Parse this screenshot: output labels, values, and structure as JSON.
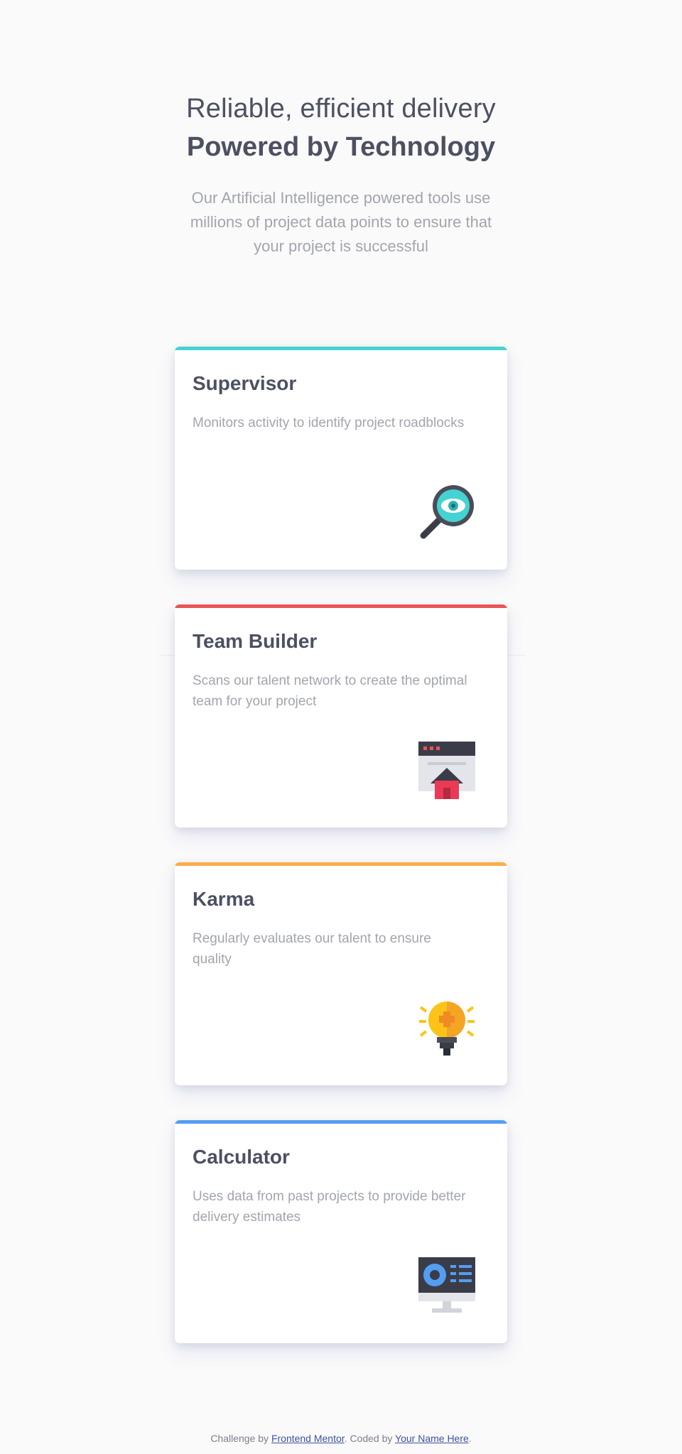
{
  "header": {
    "headline_light": "Reliable, efficient delivery",
    "headline_bold": "Powered by Technology",
    "intro": "Our Artificial Intelligence powered tools use millions of project data points to ensure that your project is successful"
  },
  "cards": [
    {
      "title": "Supervisor",
      "description": "Monitors activity to identify project roadblocks",
      "accent_color": "#44d3d2",
      "icon": "magnifier-eye-icon"
    },
    {
      "title": "Team Builder",
      "description": "Scans our talent network to create the optimal team for your project",
      "accent_color": "#ea5454",
      "icon": "browser-house-icon"
    },
    {
      "title": "Karma",
      "description": "Regularly evaluates our talent to ensure quality",
      "accent_color": "#fcae4a",
      "icon": "lightbulb-icon"
    },
    {
      "title": "Calculator",
      "description": "Uses data from past projects to provide better delivery estimates",
      "accent_color": "#549ef2",
      "icon": "monitor-chart-icon"
    }
  ],
  "footer": {
    "prefix": "Challenge by ",
    "link1": "Frontend Mentor",
    "middle": ". Coded by ",
    "link2": "Your Name Here",
    "suffix": "."
  }
}
